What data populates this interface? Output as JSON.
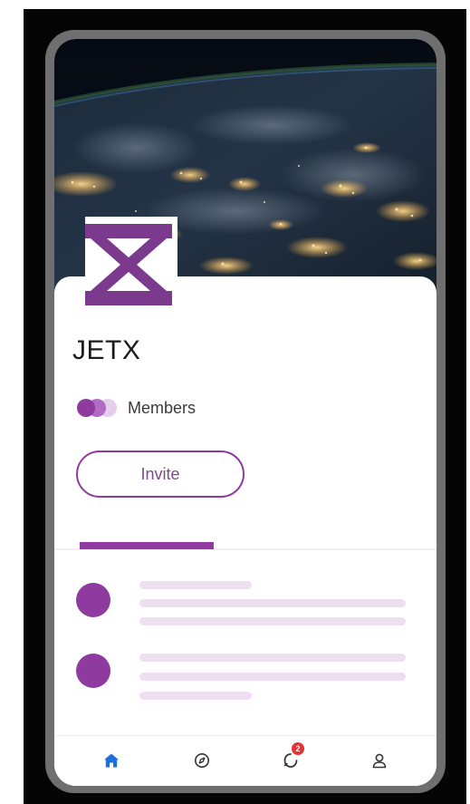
{
  "group": {
    "name": "JETX",
    "logo_letter": "X"
  },
  "members": {
    "label": "Members"
  },
  "actions": {
    "invite_label": "Invite"
  },
  "bottom_nav": {
    "items": [
      {
        "icon": "home-icon",
        "active": true
      },
      {
        "icon": "compass-icon",
        "active": false
      },
      {
        "icon": "notifications-icon",
        "active": false,
        "badge": "2"
      },
      {
        "icon": "profile-icon",
        "active": false
      }
    ]
  },
  "colors": {
    "accent": "#8e3a9f",
    "accent_light": "#eddff0",
    "active_nav": "#1c6fe0",
    "badge": "#e83131"
  }
}
